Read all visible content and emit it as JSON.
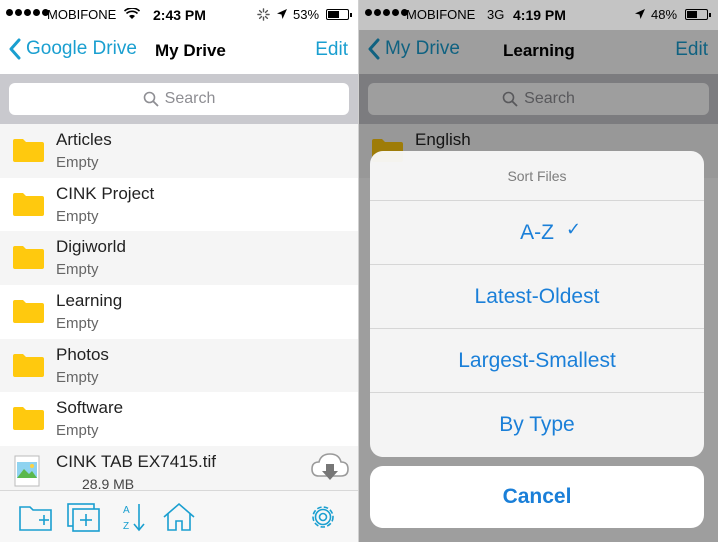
{
  "left": {
    "status": {
      "carrier": "MOBIFONE",
      "time": "2:43 PM",
      "battery": "53%"
    },
    "nav": {
      "back_label": "Google Drive",
      "title": "My Drive",
      "edit_label": "Edit"
    },
    "search": {
      "placeholder": "Search"
    },
    "folders": [
      {
        "name": "Articles",
        "detail": "Empty"
      },
      {
        "name": "CINK Project",
        "detail": "Empty"
      },
      {
        "name": "Digiworld",
        "detail": "Empty"
      },
      {
        "name": "Learning",
        "detail": "Empty"
      },
      {
        "name": "Photos",
        "detail": "Empty"
      },
      {
        "name": "Software",
        "detail": "Empty"
      }
    ],
    "file": {
      "name": "CINK TAB EX7415.tif",
      "size": "28.9 MB"
    },
    "toolbar": {
      "icons": [
        "new-folder-icon",
        "add-file-icon",
        "sort-az-icon",
        "home-icon",
        "settings-icon"
      ],
      "sort_letters": {
        "top": "A",
        "bottom": "Z"
      }
    }
  },
  "right": {
    "status": {
      "carrier": "MOBIFONE",
      "network": "3G",
      "time": "4:19 PM",
      "battery": "48%"
    },
    "nav": {
      "back_label": "My Drive",
      "title": "Learning",
      "edit_label": "Edit"
    },
    "search": {
      "placeholder": "Search"
    },
    "background_item": "English",
    "sheet": {
      "title": "Sort Files",
      "options": [
        "A-Z",
        "Latest-Oldest",
        "Largest-Smallest",
        "By Type"
      ],
      "selected": "A-Z",
      "check": "✓",
      "cancel": "Cancel"
    }
  },
  "colors": {
    "accent": "#1a9fd0",
    "folder": "#ffc90e",
    "sheet_text": "#1a7fd8"
  }
}
